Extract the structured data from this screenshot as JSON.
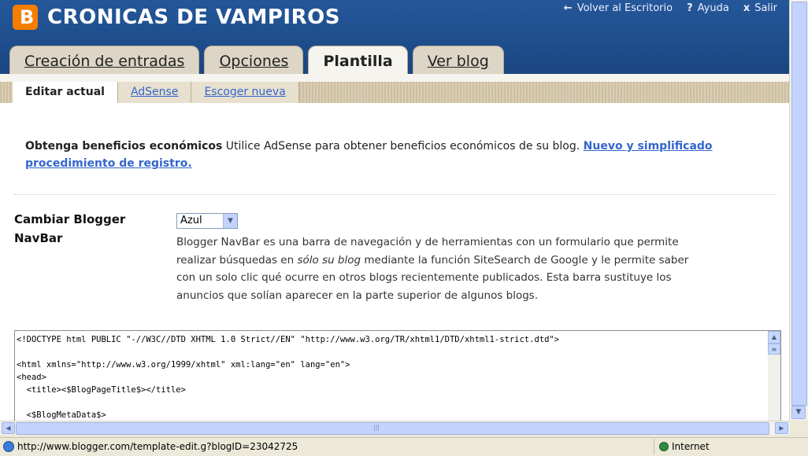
{
  "header": {
    "blog_title": "CRONICAS DE VAMPIROS",
    "logo_letter": "B",
    "links": [
      {
        "label": "Volver al Escritorio",
        "icon": "back-arrow-icon"
      },
      {
        "label": "Ayuda",
        "icon": "help-icon"
      },
      {
        "label": "Salir",
        "icon": "close-icon"
      }
    ],
    "link_glyphs": [
      "←",
      "?",
      "x"
    ]
  },
  "tabs": [
    {
      "label": "Creación de entradas",
      "active": false
    },
    {
      "label": "Opciones",
      "active": false
    },
    {
      "label": "Plantilla",
      "active": true
    },
    {
      "label": "Ver blog",
      "active": false
    }
  ],
  "subtabs": [
    {
      "label": "Editar actual",
      "active": true
    },
    {
      "label": "AdSense",
      "active": false
    },
    {
      "label": "Escoger nueva",
      "active": false
    }
  ],
  "promo": {
    "bold": "Obtenga beneficios económicos",
    "text": " Utilice AdSense para obtener beneficios económicos de su blog. ",
    "link": "Nuevo y simplificado procedimiento de registro."
  },
  "navbar": {
    "label": "Cambiar Blogger NavBar",
    "selected": "Azul",
    "desc_1": "Blogger NavBar es una barra de navegación y de herramientas con un formulario que permite realizar búsquedas en ",
    "desc_italic": "sólo su blog",
    "desc_2": " mediante la función SiteSearch de Google y le permite saber con un solo clic qué ocurre en otros blogs recientemente publicados. Esta barra sustituye los anuncios que solían aparecer en la parte superior de algunos blogs."
  },
  "template_code": "<!DOCTYPE html PUBLIC \"-//W3C//DTD XHTML 1.0 Strict//EN\" \"http://www.w3.org/TR/xhtml1/DTD/xhtml1-strict.dtd\">\n\n<html xmlns=\"http://www.w3.org/1999/xhtml\" xml:lang=\"en\" lang=\"en\">\n<head>\n  <title><$BlogPageTitle$></title>\n\n  <$BlogMetaData$>",
  "status": {
    "url": "http://www.blogger.com/template-edit.g?blogID=23042725",
    "zone": "Internet"
  },
  "colors": {
    "header_bg": "#1f4e8c",
    "link": "#3366cc",
    "logo": "#f57d00"
  }
}
